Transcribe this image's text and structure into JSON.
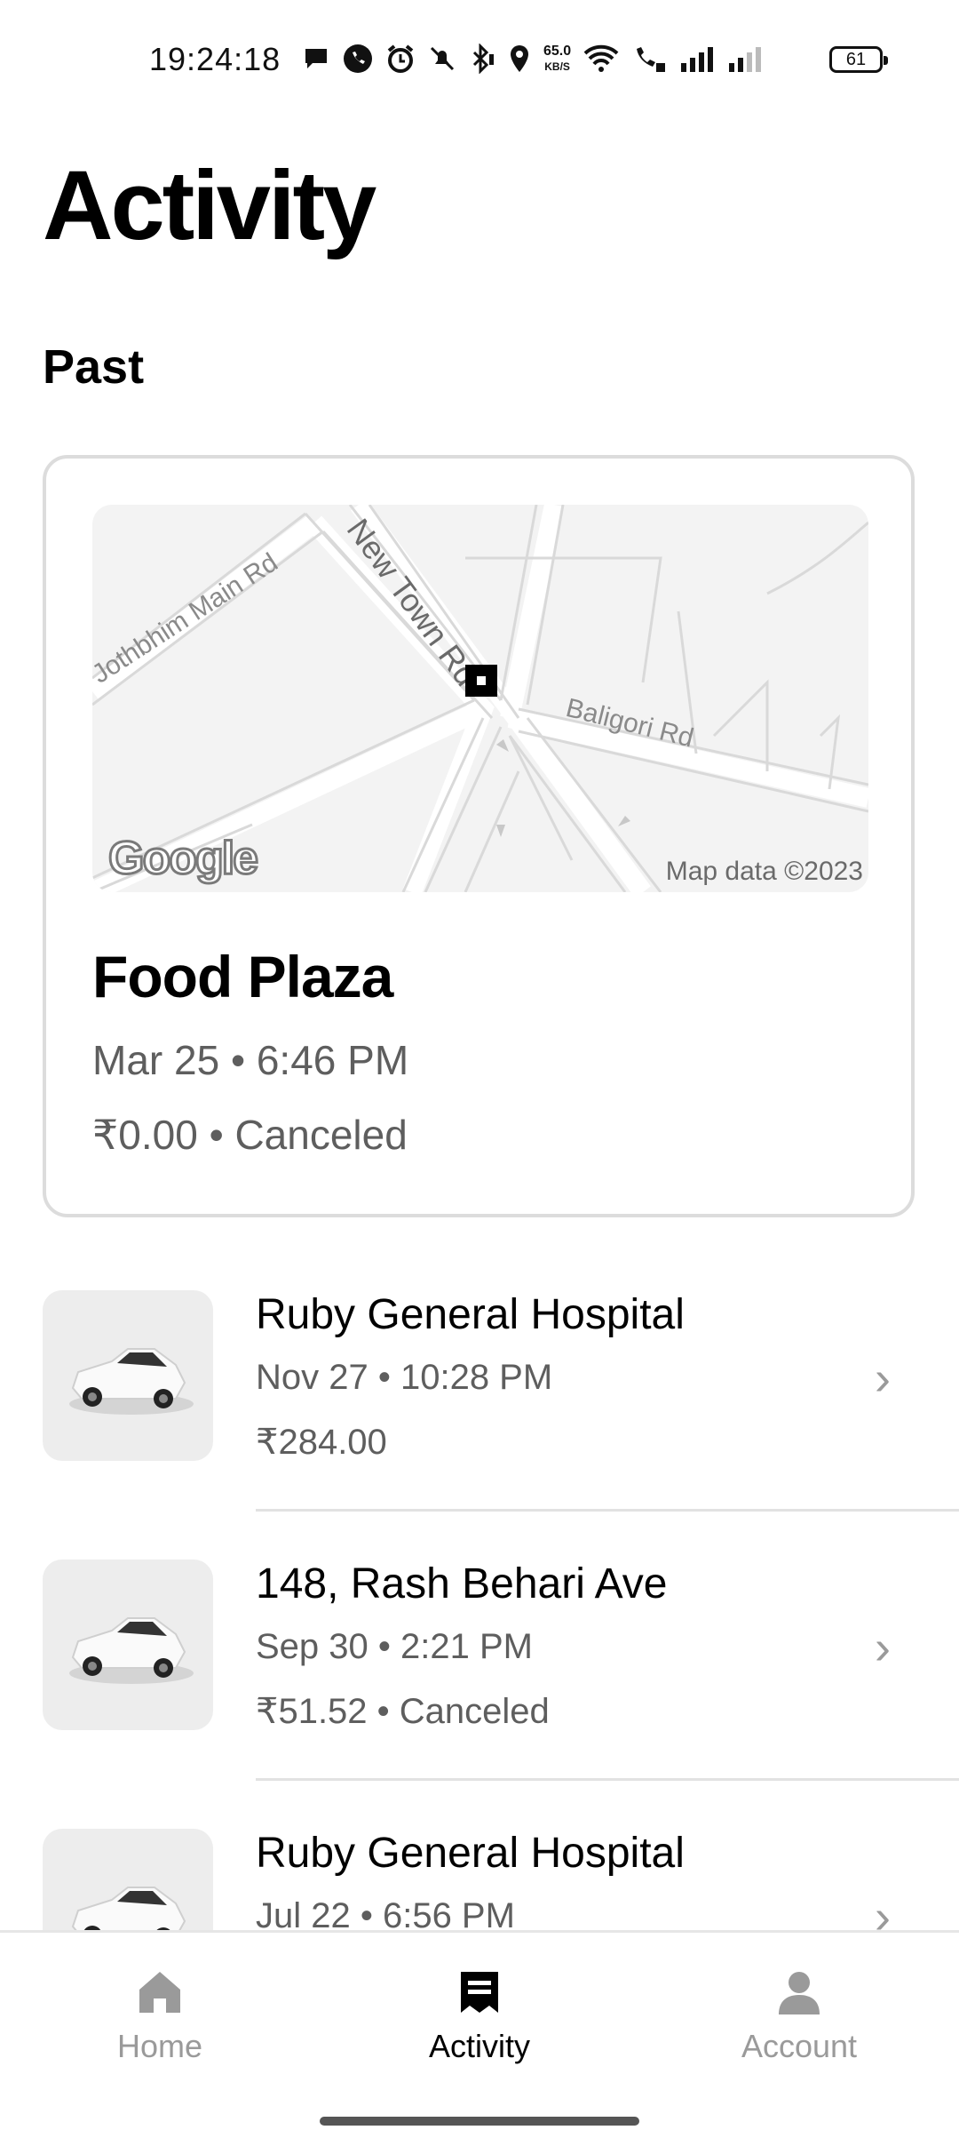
{
  "status_bar": {
    "time": "19:24:18",
    "speed_top": "65.0",
    "speed_bottom": "KB/S",
    "battery": "61",
    "icons": [
      "chat-bubble-icon",
      "phone-icon",
      "alarm-icon",
      "mute-icon",
      "bluetooth-icon",
      "location-icon",
      "wifi-icon",
      "wifi-call-icon",
      "signal-icon",
      "signal-weak-icon",
      "battery-icon"
    ]
  },
  "page": {
    "title": "Activity",
    "section": "Past"
  },
  "featured": {
    "map": {
      "roads": [
        "Jothbhim Main Rd",
        "New Town Rd",
        "Baligori Rd"
      ],
      "logo": "Google",
      "attribution": "Map data ©2023"
    },
    "title": "Food Plaza",
    "datetime": "Mar 25 • 6:46 PM",
    "price_status": "₹0.00 • Canceled"
  },
  "trips": [
    {
      "title": "Ruby General Hospital",
      "datetime": "Nov 27 • 10:28 PM",
      "price": "₹284.00"
    },
    {
      "title": "148, Rash Behari Ave",
      "datetime": "Sep 30 • 2:21 PM",
      "price": "₹51.52 • Canceled"
    },
    {
      "title": "Ruby General Hospital",
      "datetime": "Jul 22 • 6:56 PM",
      "price": ""
    }
  ],
  "nav": {
    "home": "Home",
    "activity": "Activity",
    "account": "Account",
    "active": "Activity"
  },
  "colors": {
    "text_primary": "#000000",
    "text_secondary": "#5e5e5e",
    "inactive_nav": "#9a9a9a",
    "card_border": "#dcdcdc"
  }
}
